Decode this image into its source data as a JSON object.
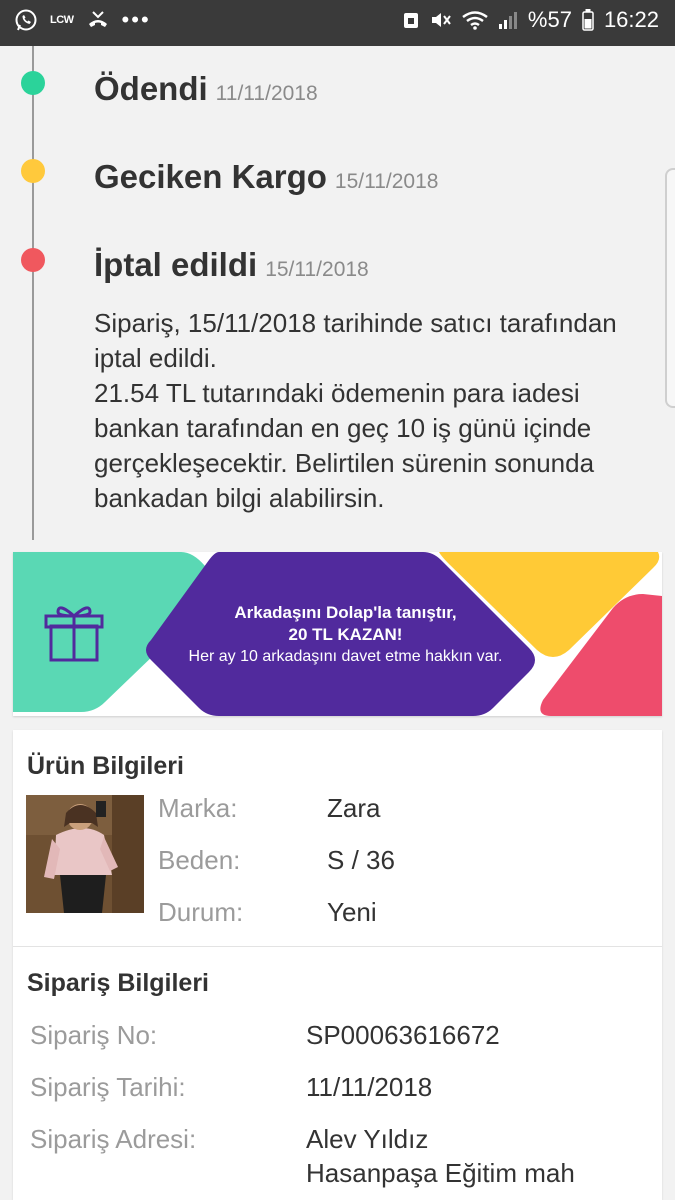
{
  "status_bar": {
    "carrier_badge": "LCW",
    "overflow": "•••",
    "battery": "%57",
    "time": "16:22",
    "icons": [
      "whatsapp-icon",
      "lcw-badge",
      "missed-call-icon",
      "alarm-icon",
      "mute-icon",
      "wifi-icon",
      "signal-icon",
      "battery-icon"
    ]
  },
  "timeline": [
    {
      "status": "Ödendi",
      "date": "11/11/2018",
      "color": "#2bd39a"
    },
    {
      "status": "Geciken Kargo",
      "date": "15/11/2018",
      "color": "#ffc93c"
    },
    {
      "status": "İptal edildi",
      "date": "15/11/2018",
      "color": "#f0585e"
    }
  ],
  "cancel_message": {
    "line1": "Sipariş, 15/11/2018 tarihinde satıcı tarafından iptal edildi.",
    "line2": "21.54 TL tutarındaki ödemenin para iadesi bankan tarafından en geç 10 iş günü içinde gerçekleşecektir. Belirtilen sürenin sonunda bankadan bilgi alabilirsin."
  },
  "banner": {
    "line1": "Arkadaşını Dolap'la tanıştır,",
    "line2": "20 TL KAZAN!",
    "line3": "Her ay 10 arkadaşını davet etme hakkın var.",
    "colors": {
      "green": "#5ad8b4",
      "purple": "#512a9d",
      "yellow": "#ffca36",
      "pink": "#ee4c6c"
    }
  },
  "product_info": {
    "title": "Ürün Bilgileri",
    "rows": [
      {
        "label": "Marka:",
        "value": "Zara"
      },
      {
        "label": "Beden:",
        "value": "S / 36"
      },
      {
        "label": "Durum:",
        "value": "Yeni"
      }
    ]
  },
  "order_info": {
    "title": "Sipariş Bilgileri",
    "rows": [
      {
        "label": "Sipariş No:",
        "value": "SP00063616672"
      },
      {
        "label": "Sipariş Tarihi:",
        "value": "11/11/2018"
      },
      {
        "label": "Sipariş Adresi:",
        "value": "Alev Yıldız"
      }
    ],
    "address_line2": "Hasanpaşa Eğitim mah"
  }
}
